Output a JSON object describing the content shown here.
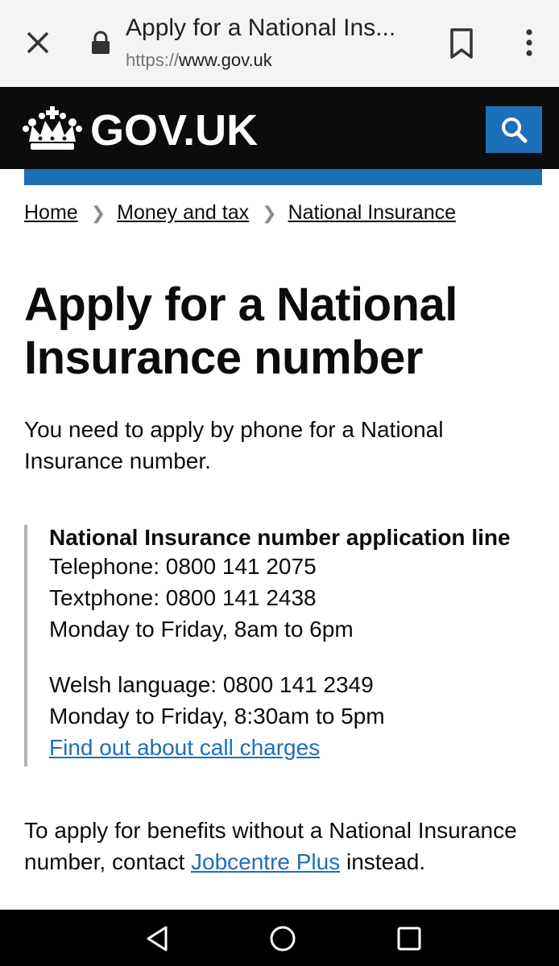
{
  "browser": {
    "tab_title": "Apply for a National Ins...",
    "url_scheme": "https://",
    "url_host": "www.gov.uk",
    "icons": [
      "close-icon",
      "lock-icon",
      "bookmark-icon",
      "more-vert-icon"
    ]
  },
  "header": {
    "logo_text": "GOV.UK",
    "brand_color": "#1d70b8",
    "background": "#0b0c0c"
  },
  "breadcrumb": [
    {
      "label": "Home"
    },
    {
      "label": "Money and tax"
    },
    {
      "label": "National Insurance"
    }
  ],
  "page": {
    "title": "Apply for a National Insurance number",
    "lede": "You need to apply by phone for a National Insurance number."
  },
  "contact": {
    "heading": "National Insurance number application line",
    "telephone": "Telephone: 0800 141 2075",
    "textphone": "Textphone: 0800 141 2438",
    "hours": "Monday to Friday, 8am to 6pm",
    "welsh": "Welsh language: 0800 141 2349",
    "welsh_hours": "Monday to Friday, 8:30am to 5pm",
    "charges_link": "Find out about call charges"
  },
  "benefits": {
    "text_before": "To apply for benefits without a National Insurance number, contact ",
    "link": "Jobcentre Plus",
    "text_after": " instead."
  },
  "navbar": {
    "icons": [
      "back-icon",
      "home-icon",
      "recents-icon"
    ]
  }
}
